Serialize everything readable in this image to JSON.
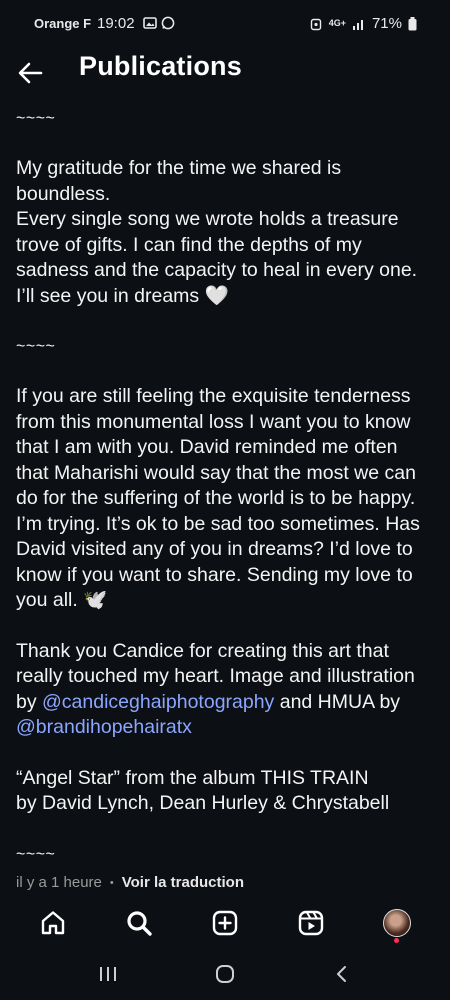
{
  "status_bar": {
    "carrier": "Orange F",
    "time": "19:02",
    "network": "4G+",
    "battery": "71%"
  },
  "header": {
    "title": "Publications"
  },
  "post": {
    "separator": "~~~~",
    "p1": "My gratitude for the time we shared is\nboundless.\nEvery single song we wrote holds a treasure\ntrove of gifts. I can find the depths of my\nsadness and the capacity to heal in every one.\nI’ll see you in dreams 🤍",
    "p2": "If you are still feeling the exquisite tenderness\nfrom this monumental loss I want you to know\nthat I am with you. David reminded me often\nthat Maharishi would say that the most we can\ndo for the suffering of the world is to be happy.\nI’m trying. It’s ok to be sad too sometimes. Has\nDavid visited any of you in dreams? I’d love to\nknow if you want to share. Sending my love to\nyou all. 🕊️",
    "p3_line1": "Thank you Candice for creating this art that",
    "p3_line2": "really touched my heart. Image and illustration",
    "p3_by": "by ",
    "p3_mention1": "@candiceghaiphotography",
    "p3_and": " and HMUA by",
    "p3_mention2": "@brandihopehairatx",
    "p4": "“Angel Star” from the album THIS TRAIN\nby David Lynch, Dean Hurley & Chrystabell"
  },
  "meta": {
    "time_ago": "il y a 1 heure",
    "dot": "•",
    "translate": "Voir la traduction"
  },
  "bottom_nav": [
    "home-icon",
    "search-icon",
    "create-icon",
    "reels-icon",
    "profile-avatar"
  ],
  "system_nav": [
    "recents-icon",
    "home-circle-icon",
    "back-chevron-icon"
  ],
  "colors": {
    "background": "#0c0f14",
    "text": "#f4f4f4",
    "link": "#8aa6ff",
    "meta": "#9a9a9a"
  }
}
